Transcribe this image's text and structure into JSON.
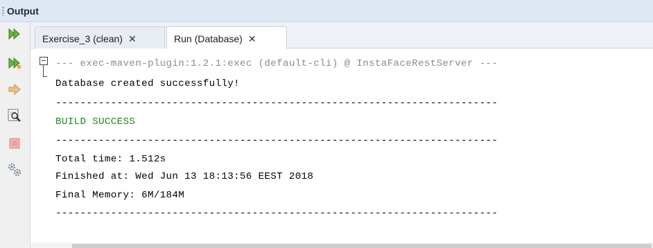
{
  "window": {
    "title": "Output"
  },
  "tabs": [
    {
      "label": "Exercise_3 (clean)",
      "close": "✕",
      "active": false
    },
    {
      "label": "Run (Database)",
      "close": "✕",
      "active": true
    }
  ],
  "toolbar": {
    "buttons": [
      {
        "icon": "rerun-icon",
        "color": "#6cb33f"
      },
      {
        "icon": "rerun-with-options-icon",
        "color": "#6cb33f"
      },
      {
        "icon": "forward-arrow-icon",
        "color": "#e0a95c"
      },
      {
        "icon": "find-icon",
        "color": "#555555"
      },
      {
        "icon": "stop-icon",
        "color": "#e29a9a"
      },
      {
        "icon": "settings-icon",
        "color": "#7a8aa0"
      }
    ]
  },
  "output": {
    "lines": [
      "--- exec-maven-plugin:1.2.1:exec (default-cli) @ InstaFaceRestServer ---",
      "Database created successfully!",
      "------------------------------------------------------------------------",
      "BUILD SUCCESS",
      "------------------------------------------------------------------------",
      "Total time: 1.512s",
      "Finished at: Wed Jun 13 18:13:56 EEST 2018",
      "Final Memory: 6M/184M",
      "------------------------------------------------------------------------"
    ]
  },
  "colors": {
    "header_text": "#8c8c8c",
    "normal_text": "#000000",
    "success_text": "#1a8a1a"
  }
}
